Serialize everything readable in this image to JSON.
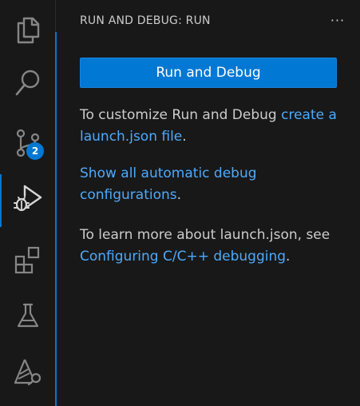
{
  "activity_bar": {
    "items": [
      {
        "icon": "files-icon"
      },
      {
        "icon": "search-icon"
      },
      {
        "icon": "source-control-icon",
        "badge": "2"
      },
      {
        "icon": "run-debug-icon"
      },
      {
        "icon": "extensions-icon"
      },
      {
        "icon": "testing-flask-icon"
      },
      {
        "icon": "remote-explorer-icon"
      }
    ],
    "accent": "#0078d4"
  },
  "sidebar": {
    "title": "RUN AND DEBUG: RUN",
    "more": "···",
    "run_button": "Run and Debug",
    "p1": {
      "text": "To customize Run and Debug ",
      "link": "create a launch.json file",
      "after": "."
    },
    "p2": {
      "link": "Show all automatic debug configurations",
      "after": "."
    },
    "p3": {
      "text": "To learn more about launch.json, see ",
      "link": "Configuring C/C++ debugging",
      "after": "."
    }
  },
  "colors": {
    "background": "#181818",
    "text": "#cccccc",
    "link": "#4daafc",
    "button": "#0078d4"
  }
}
